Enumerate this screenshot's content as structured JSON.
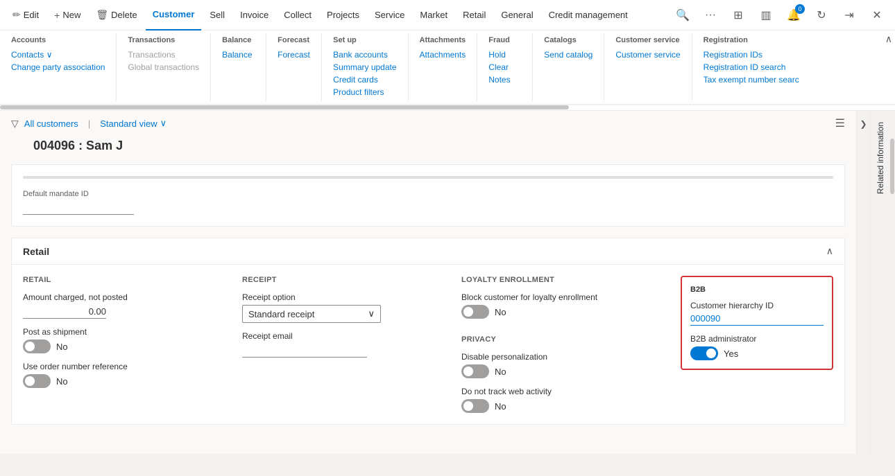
{
  "topNav": {
    "items": [
      {
        "label": "Edit",
        "icon": "✏️",
        "active": false,
        "name": "edit"
      },
      {
        "label": "New",
        "icon": "+",
        "active": false,
        "name": "new"
      },
      {
        "label": "Delete",
        "icon": "🗑️",
        "active": false,
        "name": "delete"
      },
      {
        "label": "Customer",
        "icon": "",
        "active": true,
        "name": "customer"
      },
      {
        "label": "Sell",
        "icon": "",
        "active": false,
        "name": "sell"
      },
      {
        "label": "Invoice",
        "icon": "",
        "active": false,
        "name": "invoice"
      },
      {
        "label": "Collect",
        "icon": "",
        "active": false,
        "name": "collect"
      },
      {
        "label": "Projects",
        "icon": "",
        "active": false,
        "name": "projects"
      },
      {
        "label": "Service",
        "icon": "",
        "active": false,
        "name": "service"
      },
      {
        "label": "Market",
        "icon": "",
        "active": false,
        "name": "market"
      },
      {
        "label": "Retail",
        "icon": "",
        "active": false,
        "name": "retail"
      },
      {
        "label": "General",
        "icon": "",
        "active": false,
        "name": "general"
      },
      {
        "label": "Credit management",
        "icon": "",
        "active": false,
        "name": "credit-management"
      }
    ],
    "rightIcons": [
      "search",
      "more",
      "grid",
      "panel",
      "notification",
      "refresh",
      "forward",
      "close"
    ]
  },
  "megaMenu": {
    "sections": [
      {
        "title": "Accounts",
        "name": "accounts",
        "links": [
          {
            "label": "Contacts ∨",
            "active": true,
            "name": "contacts"
          },
          {
            "label": "Change party association",
            "active": true,
            "name": "change-party"
          }
        ]
      },
      {
        "title": "Transactions",
        "name": "transactions",
        "links": [
          {
            "label": "Transactions",
            "active": false,
            "name": "transactions"
          },
          {
            "label": "Global transactions",
            "active": false,
            "name": "global-transactions"
          }
        ]
      },
      {
        "title": "Balance",
        "name": "balance",
        "links": [
          {
            "label": "Balance",
            "active": true,
            "name": "balance"
          }
        ]
      },
      {
        "title": "Forecast",
        "name": "forecast",
        "links": [
          {
            "label": "Forecast",
            "active": true,
            "name": "forecast"
          }
        ]
      },
      {
        "title": "Set up",
        "name": "setup",
        "links": [
          {
            "label": "Bank accounts",
            "active": true,
            "name": "bank-accounts"
          },
          {
            "label": "Summary update",
            "active": true,
            "name": "summary-update"
          },
          {
            "label": "Credit cards",
            "active": true,
            "name": "credit-cards"
          },
          {
            "label": "Product filters",
            "active": true,
            "name": "product-filters"
          }
        ]
      },
      {
        "title": "Attachments",
        "name": "attachments",
        "links": [
          {
            "label": "Attachments",
            "active": true,
            "name": "attachments"
          }
        ]
      },
      {
        "title": "Fraud",
        "name": "fraud",
        "links": [
          {
            "label": "Hold",
            "active": true,
            "name": "hold"
          },
          {
            "label": "Clear",
            "active": true,
            "name": "clear"
          },
          {
            "label": "Notes",
            "active": true,
            "name": "notes"
          }
        ]
      },
      {
        "title": "Catalogs",
        "name": "catalogs",
        "links": [
          {
            "label": "Send catalog",
            "active": true,
            "name": "send-catalog"
          }
        ]
      },
      {
        "title": "Customer service",
        "name": "customer-service",
        "links": [
          {
            "label": "Customer service",
            "active": true,
            "name": "customer-service-link"
          }
        ]
      },
      {
        "title": "Registration",
        "name": "registration",
        "links": [
          {
            "label": "Registration IDs",
            "active": true,
            "name": "registration-ids"
          },
          {
            "label": "Registration ID search",
            "active": true,
            "name": "registration-id-search"
          },
          {
            "label": "Tax exempt number searc",
            "active": true,
            "name": "tax-exempt"
          }
        ]
      }
    ]
  },
  "breadcrumb": {
    "allLabel": "All customers",
    "viewLabel": "Standard view",
    "viewIcon": "∨"
  },
  "pageTitle": "004096 : Sam J",
  "mandateField": {
    "label": "Default mandate ID",
    "value": ""
  },
  "retailSection": {
    "title": "Retail",
    "retail": {
      "groupTitle": "RETAIL",
      "amountLabel": "Amount charged, not posted",
      "amountValue": "0.00",
      "postAsShipmentLabel": "Post as shipment",
      "postAsShipmentToggle": false,
      "postAsShipmentText": "No",
      "useOrderNumberLabel": "Use order number reference",
      "useOrderNumberToggle": false,
      "useOrderNumberText": "No"
    },
    "receipt": {
      "groupTitle": "RECEIPT",
      "receiptOptionLabel": "Receipt option",
      "receiptOptionValue": "Standard receipt",
      "receiptEmailLabel": "Receipt email",
      "receiptEmailValue": ""
    },
    "loyaltyEnrollment": {
      "groupTitle": "LOYALTY ENROLLMENT",
      "blockLabel": "Block customer for loyalty enrollment",
      "blockToggle": false,
      "blockText": "No",
      "privacyGroupTitle": "PRIVACY",
      "disablePersonalizationLabel": "Disable personalization",
      "disablePersonalizationToggle": false,
      "disablePersonalizationText": "No",
      "doNotTrackLabel": "Do not track web activity",
      "doNotTrackToggle": false,
      "doNotTrackText": "No"
    },
    "b2b": {
      "groupTitle": "B2B",
      "customerHierarchyLabel": "Customer hierarchy ID",
      "customerHierarchyValue": "000090",
      "b2bAdminLabel": "B2B administrator",
      "b2bAdminToggle": true,
      "b2bAdminText": "Yes"
    }
  },
  "relatedInfo": {
    "label": "Related information"
  }
}
